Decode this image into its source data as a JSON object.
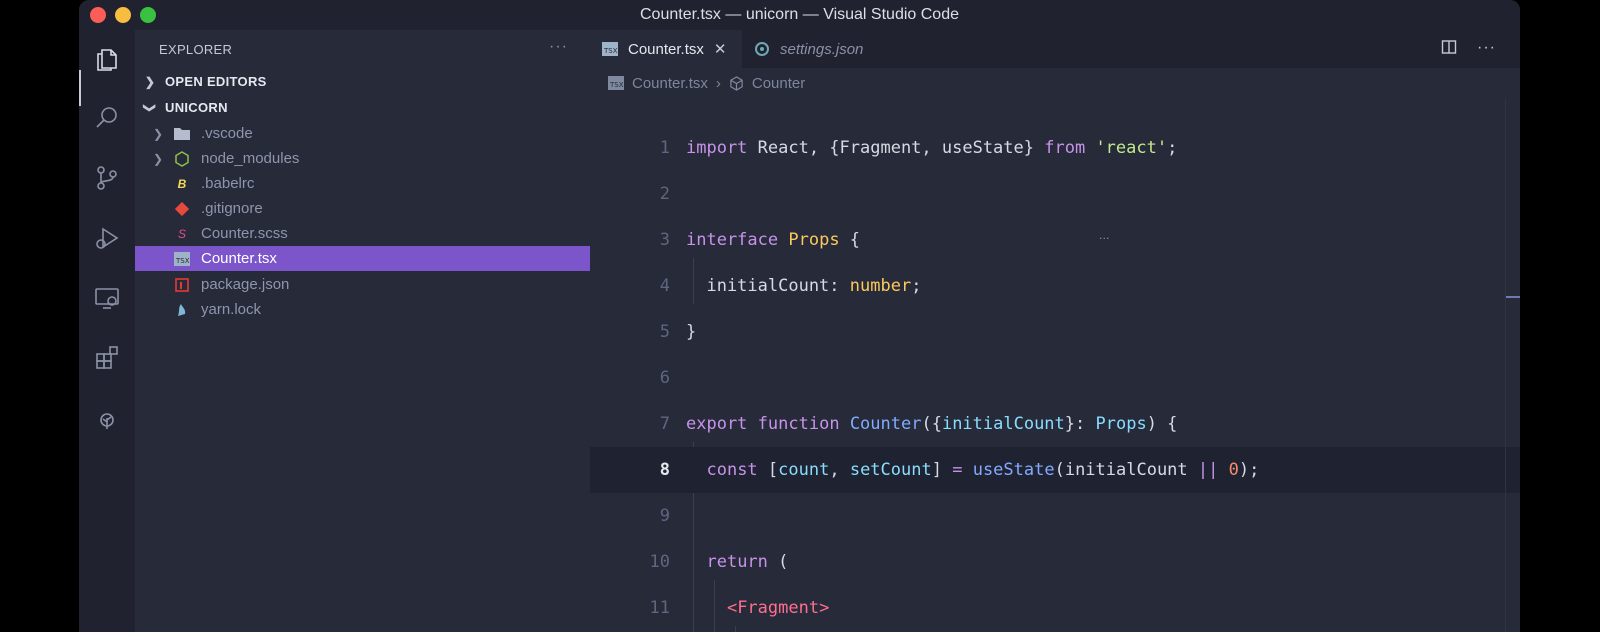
{
  "window": {
    "title": "Counter.tsx — unicorn — Visual Studio Code"
  },
  "activity_bar": {
    "icons": [
      "files-icon",
      "search-icon",
      "source-control-icon",
      "run-debug-icon",
      "remote-explorer-icon",
      "extensions-icon",
      "tree-icon"
    ]
  },
  "sidebar": {
    "header": "EXPLORER",
    "more_label": "···",
    "sections": {
      "open_editors": "OPEN EDITORS",
      "project": "UNICORN"
    },
    "files": [
      {
        "label": ".vscode",
        "icon": "folder-icon",
        "expandable": true
      },
      {
        "label": "node_modules",
        "icon": "node-folder-icon",
        "expandable": true
      },
      {
        "label": ".babelrc",
        "icon": "babel-icon",
        "expandable": false
      },
      {
        "label": ".gitignore",
        "icon": "git-icon",
        "expandable": false
      },
      {
        "label": "Counter.scss",
        "icon": "sass-icon",
        "expandable": false
      },
      {
        "label": "Counter.tsx",
        "icon": "tsx-icon",
        "expandable": false,
        "selected": true
      },
      {
        "label": "package.json",
        "icon": "npm-icon",
        "expandable": false
      },
      {
        "label": "yarn.lock",
        "icon": "yarn-icon",
        "expandable": false
      }
    ]
  },
  "editor": {
    "tabs": [
      {
        "label": "Counter.tsx",
        "active": true
      },
      {
        "label": "settings.json",
        "active": false
      }
    ],
    "breadcrumb": {
      "file": "Counter.tsx",
      "symbol": "Counter"
    },
    "current_line": 8,
    "lines": [
      {
        "n": "1"
      },
      {
        "n": "2"
      },
      {
        "n": "3"
      },
      {
        "n": "4"
      },
      {
        "n": "5"
      },
      {
        "n": "6"
      },
      {
        "n": "7"
      },
      {
        "n": "8"
      },
      {
        "n": "9"
      },
      {
        "n": "10"
      },
      {
        "n": "11"
      }
    ]
  },
  "colors": {
    "selection": "#7b55c9",
    "keyword": "#c792ea",
    "type": "#fbc95d",
    "function": "#82aaff",
    "string": "#c3e88d",
    "number": "#f78c6c",
    "tag": "#ff6f8d"
  }
}
